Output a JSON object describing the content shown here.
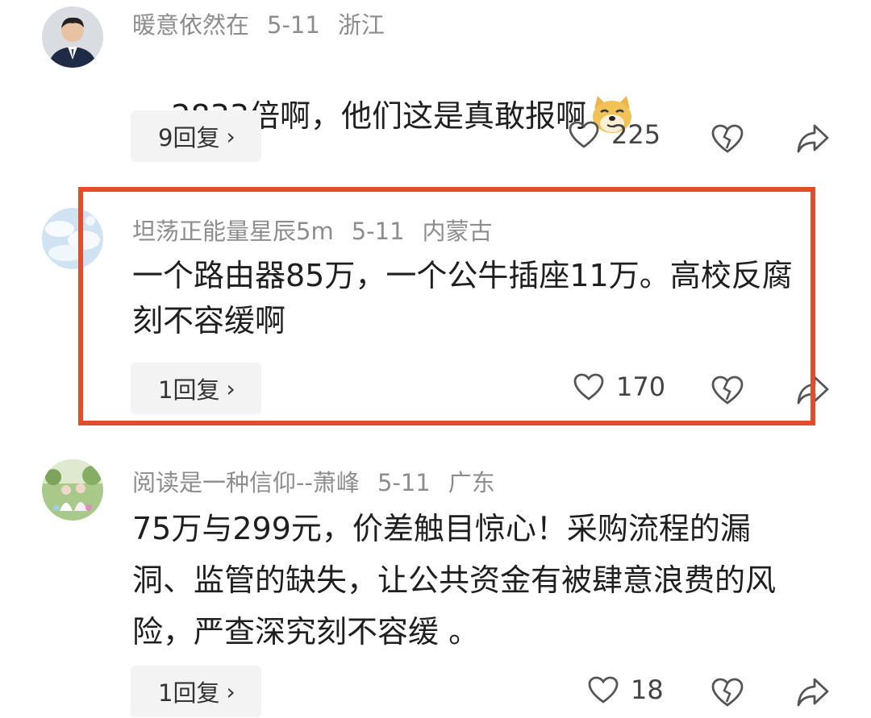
{
  "comments": [
    {
      "username": "暖意依然在",
      "date": "5-11",
      "location": "浙江",
      "text": "2833倍啊，他们这是真敢报啊",
      "emoji": "doge-emoji",
      "reply_label": "9回复",
      "likes": "225",
      "avatar": "man-in-suit-avatar"
    },
    {
      "username": "坦荡正能量星辰5m",
      "date": "5-11",
      "location": "内蒙古",
      "text": "一个路由器85万，一个公牛插座11万。高校反腐刻不容缓啊",
      "reply_label": "1回复",
      "likes": "170",
      "avatar": "sky-clouds-avatar"
    },
    {
      "username": "阅读是一种信仰--萧峰",
      "date": "5-11",
      "location": "广东",
      "text": "75万与299元，价差触目惊心！采购流程的漏洞、监管的缺失，让公共资金有被肆意浪费的风险，严查深究刻不容缓 。",
      "reply_label": "1回复",
      "likes": "18",
      "avatar": "outdoor-photo-avatar"
    }
  ],
  "colors": {
    "highlight_border": "#e24d2c",
    "meta_text": "#8d8d8d",
    "pill_bg": "#f3f3f3"
  }
}
